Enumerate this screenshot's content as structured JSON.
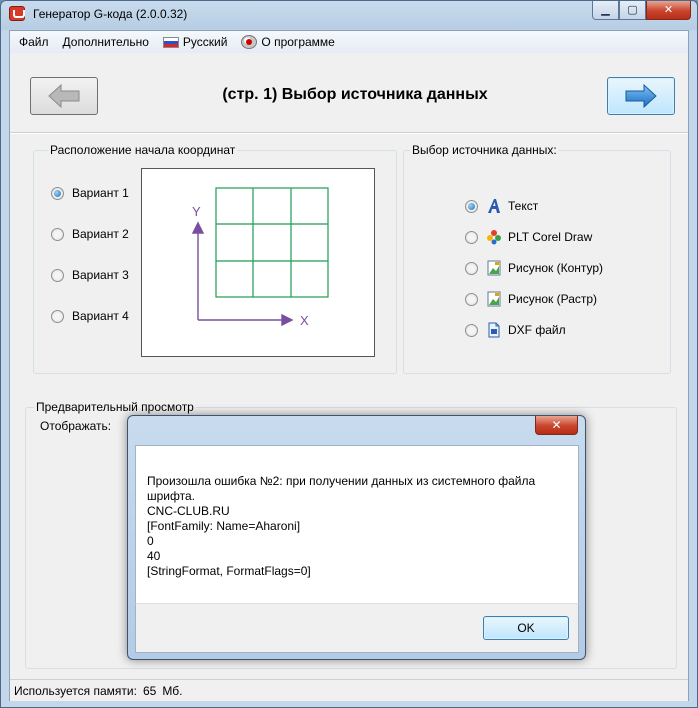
{
  "window": {
    "title": "Генератор G-кода (2.0.0.32)",
    "minimize_glyph": "▁",
    "maximize_glyph": "▢",
    "close_glyph": "✕"
  },
  "menu": {
    "items": [
      {
        "label": "Файл"
      },
      {
        "label": "Дополнительно"
      },
      {
        "label": "Русский",
        "icon": "russia-flag-icon"
      },
      {
        "label": "О программе",
        "icon": "about-icon"
      }
    ]
  },
  "header": {
    "title": "(стр. 1) Выбор источника данных",
    "back_icon": "arrow-left-icon",
    "next_icon": "arrow-right-icon"
  },
  "origin_group": {
    "legend": "Расположение начала координат",
    "options": [
      {
        "label": "Вариант 1",
        "checked": true
      },
      {
        "label": "Вариант 2",
        "checked": false
      },
      {
        "label": "Вариант 3",
        "checked": false
      },
      {
        "label": "Вариант 4",
        "checked": false
      }
    ],
    "axis_y": "Y",
    "axis_x": "X",
    "grid_color": "#1a9e52",
    "axis_color": "#7a4fa0"
  },
  "source_group": {
    "legend": "Выбор источника данных:",
    "options": [
      {
        "label": "Текст",
        "icon": "text-icon",
        "checked": true
      },
      {
        "label": "PLT Corel Draw",
        "icon": "corel-icon",
        "checked": false
      },
      {
        "label": "Рисунок (Контур)",
        "icon": "image-contour-icon",
        "checked": false
      },
      {
        "label": "Рисунок (Растр)",
        "icon": "image-raster-icon",
        "checked": false
      },
      {
        "label": "DXF файл",
        "icon": "dxf-file-icon",
        "checked": false
      }
    ]
  },
  "preview_group": {
    "legend": "Предварительный просмотр",
    "show_label": "Отображать:"
  },
  "status": {
    "memory_label": "Используется памяти:",
    "memory_value": "65",
    "memory_unit": "Мб."
  },
  "dialog": {
    "lines": [
      "Произошла ошибка №2: при получении данных из системного файла",
      "шрифта.",
      "CNC-CLUB.RU",
      "[FontFamily: Name=Aharoni]",
      "0",
      "40",
      "[StringFormat, FormatFlags=0]"
    ],
    "ok_label": "OK",
    "close_glyph": "✕"
  },
  "colors": {
    "accent": "#3c7fb1",
    "arrow_blue": "#2f7fd0",
    "close_red": "#c9452d"
  }
}
